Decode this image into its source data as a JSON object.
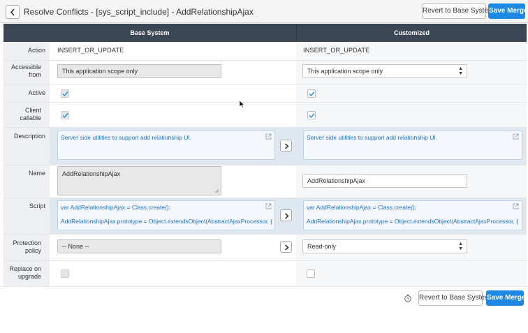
{
  "header": {
    "title": "Resolve Conflicts - [sys_script_include] - AddRelationshipAjax",
    "revert_label": "Revert to Base System",
    "save_label": "Save Merge"
  },
  "columns": {
    "base": "Base System",
    "customized": "Customized"
  },
  "labels": {
    "action": "Action",
    "accessible_from": "Accessible from",
    "active": "Active",
    "client_callable": "Client callable",
    "description": "Description",
    "name": "Name",
    "script": "Script",
    "protection_policy": "Protection policy",
    "replace_on_upgrade": "Replace on upgrade"
  },
  "base": {
    "action": "INSERT_OR_UPDATE",
    "accessible_from": "This application scope only",
    "active": true,
    "client_callable": true,
    "description": "Server side utilities to support add relationship UI.",
    "name": "AddRelationshipAjax",
    "script_line1": "var AddRelationshipAjax = Class.create();",
    "script_line2": "AddRelationshipAjax.prototype = Object.extendsObject(AbstractAjaxProcessor, {",
    "protection_policy": "-- None --",
    "replace_on_upgrade": false
  },
  "customized": {
    "action": "INSERT_OR_UPDATE",
    "accessible_from": "This application scope only",
    "active": true,
    "client_callable": true,
    "description": "Server side utilities to support add relationship UI.",
    "name": "AddRelationshipAjax",
    "script_line1": "var AddRelationshipAjax = Class.create();",
    "script_line2": "AddRelationshipAjax.prototype = Object.extendsObject(AbstractAjaxProcessor, {",
    "protection_policy": "Read-only",
    "replace_on_upgrade": false
  },
  "footer": {
    "revert_label": "Revert to Base System",
    "save_label": "Save Merge"
  },
  "icons": {
    "back": "chevron-left-icon",
    "copy_right": "chevron-right-icon",
    "open_editor": "external-link-icon",
    "timer": "stopwatch-icon",
    "check": "checkmark-icon",
    "select": "updown-caret-icon"
  },
  "colors": {
    "primary": "#1e88e5",
    "column_header": "#3b4754",
    "script_text": "#1e6fc3",
    "highlight_row": "#dfe8f1"
  }
}
